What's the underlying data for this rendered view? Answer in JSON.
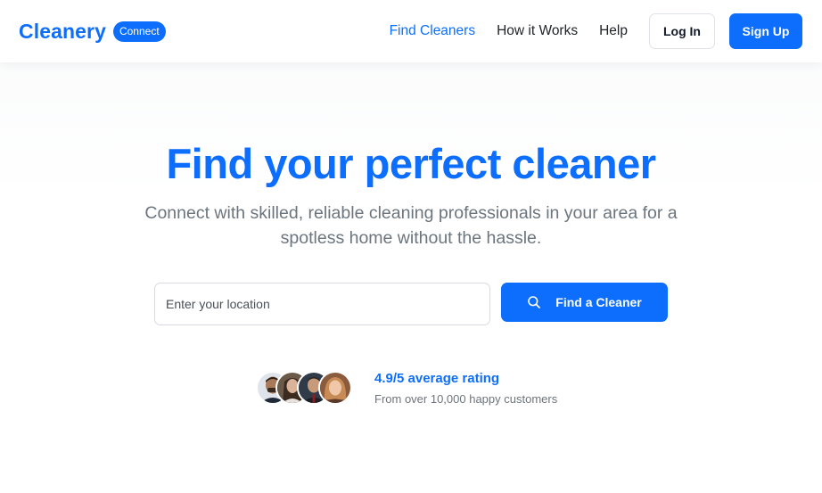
{
  "brand": {
    "name": "Cleanery",
    "badge": "Connect"
  },
  "nav": {
    "links": [
      {
        "label": "Find Cleaners",
        "active": true
      },
      {
        "label": "How it Works",
        "active": false
      },
      {
        "label": "Help",
        "active": false
      }
    ],
    "login_label": "Log In",
    "signup_label": "Sign Up"
  },
  "hero": {
    "title": "Find your perfect cleaner",
    "subtitle": "Connect with skilled, reliable cleaning professionals in your area for a spotless home without the hassle."
  },
  "search": {
    "placeholder": "Enter your location",
    "value": "",
    "button_label": "Find a Cleaner",
    "button_icon": "search-icon"
  },
  "rating": {
    "title": "4.9/5 average rating",
    "subtitle": "From over 10,000 happy customers",
    "avatars": [
      "customer-avatar-1",
      "customer-avatar-2",
      "customer-avatar-3",
      "customer-avatar-4"
    ]
  },
  "colors": {
    "accent": "#0d6efd",
    "muted_text": "#6c757d",
    "body_text": "#212529"
  }
}
